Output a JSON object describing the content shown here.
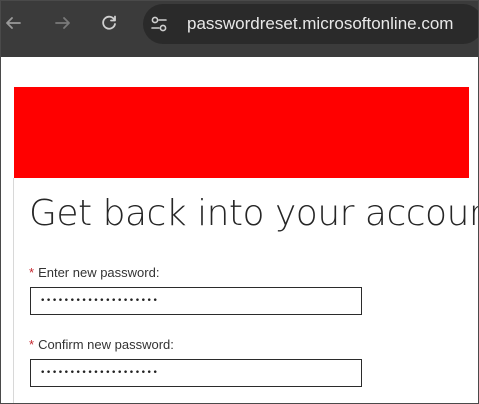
{
  "browser": {
    "back_icon": "arrow-left-icon",
    "forward_icon": "arrow-right-icon",
    "reload_icon": "reload-icon",
    "site_info_icon": "tune-icon",
    "url": "passwordreset.microsoftonline.com"
  },
  "banner": {
    "color": "#ff0000"
  },
  "page": {
    "title": "Get back into your account"
  },
  "form": {
    "required_marker": "*",
    "new_password": {
      "label": "Enter new password:",
      "value": "••••••••••••••••••••"
    },
    "confirm_password": {
      "label": "Confirm new password:",
      "value": "••••••••••••••••••••"
    }
  },
  "colors": {
    "browser_bar": "#3b3b3b",
    "address_bar": "#2a2a2a",
    "required": "#c4262e",
    "heading": "#262626"
  }
}
